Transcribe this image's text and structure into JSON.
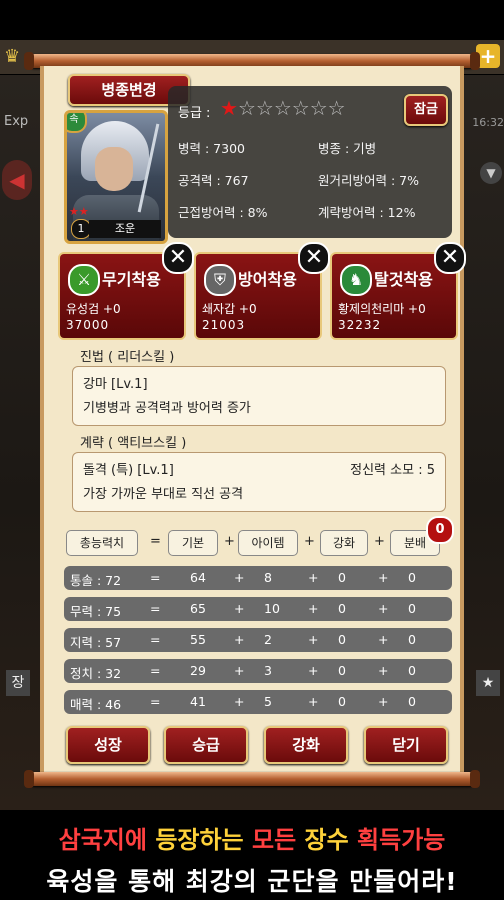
{
  "background": {
    "exp_label": "Exp",
    "time_text": "16:32",
    "side_left_label": "장",
    "side_right_label": "★"
  },
  "panel": {
    "class_change_button": "병종변경",
    "general": {
      "name": "조운",
      "level": "1",
      "stars_mini": "★★"
    },
    "grade": {
      "label": "등급 :",
      "filled_stars": 1,
      "total_stars": 7
    },
    "promote_button": "잠금",
    "stats": [
      {
        "label": "병력 : 7300"
      },
      {
        "label": "병종 : 기병"
      },
      {
        "label": "공격력 : 767"
      },
      {
        "label": "원거리방어력 : 7%"
      },
      {
        "label": "근접방어력 : 8%"
      },
      {
        "label": "계략방어력 : 12%"
      }
    ],
    "equipment": [
      {
        "title": "무기착용",
        "item": "유성검 +0",
        "code": "37000",
        "icon": "sword-icon"
      },
      {
        "title": "방어착용",
        "item": "쇄자갑 +0",
        "code": "21003",
        "icon": "armor-icon"
      },
      {
        "title": "탈것착용",
        "item": "황제의천리마 +0",
        "code": "32232",
        "icon": "horse-icon"
      }
    ],
    "leader_skill": {
      "section_title": "진법 ( 리더스킬 )",
      "name": "강마 [Lv.1]",
      "description": "기병병과 공격력과 방어력 증가"
    },
    "active_skill": {
      "section_title": "계략 ( 액티브스킬 )",
      "name": "돌격 (특) [Lv.1]",
      "cost": "정신력 소모 : 5",
      "description": "가장 가까운 부대로 직선 공격"
    },
    "calc_header": {
      "total": "총능력치",
      "base": "기본",
      "item": "아이템",
      "enhance": "강화",
      "distribute": "분배",
      "distribute_badge": "0",
      "eq": "=",
      "plus": "+"
    },
    "ability_rows": [
      {
        "label": "통솔 : 72",
        "base": "64",
        "item": "8",
        "enhance": "0",
        "distribute": "0"
      },
      {
        "label": "무력 : 75",
        "base": "65",
        "item": "10",
        "enhance": "0",
        "distribute": "0"
      },
      {
        "label": "지력 : 57",
        "base": "55",
        "item": "2",
        "enhance": "0",
        "distribute": "0"
      },
      {
        "label": "정치 : 32",
        "base": "29",
        "item": "3",
        "enhance": "0",
        "distribute": "0"
      },
      {
        "label": "매력 : 46",
        "base": "41",
        "item": "5",
        "enhance": "0",
        "distribute": "0"
      }
    ],
    "bottom_buttons": {
      "grow": "성장",
      "promote": "승급",
      "enhance": "강화",
      "close": "닫기"
    }
  },
  "banner": {
    "line1_a": "삼국지에 ",
    "line1_b": "등장하는 ",
    "line1_c": "모든 ",
    "line1_d": "장수 ",
    "line1_e": "획득가능",
    "line2": "육성을 통해 최강의 군단을 만들어라!"
  }
}
